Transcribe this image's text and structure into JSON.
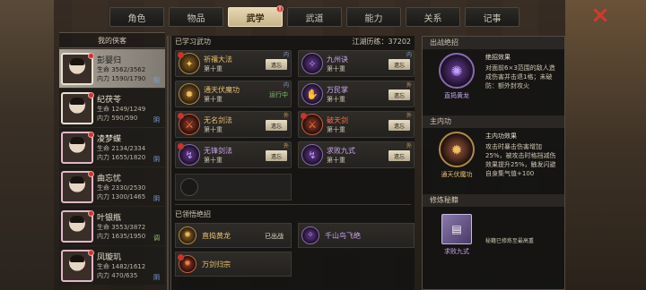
{
  "tabs": [
    {
      "label": "角色",
      "active": false,
      "dot": false
    },
    {
      "label": "物品",
      "active": false,
      "dot": false
    },
    {
      "label": "武学",
      "active": true,
      "dot": true
    },
    {
      "label": "武道",
      "active": false,
      "dot": false
    },
    {
      "label": "能力",
      "active": false,
      "dot": false
    },
    {
      "label": "关系",
      "active": false,
      "dot": false
    },
    {
      "label": "记事",
      "active": false,
      "dot": false
    }
  ],
  "close_icon": "×",
  "char_list": {
    "header": "我的侠客",
    "chars": [
      {
        "name": "彭婴归",
        "hp": "生命 3562/3562",
        "mp": "内力 1590/1790",
        "tag": "阳",
        "selected": true
      },
      {
        "name": "纪茯苓",
        "hp": "生命 1249/1249",
        "mp": "内力 590/590",
        "tag": "阴",
        "selected": false
      },
      {
        "name": "凌梦蝶",
        "hp": "生命 2134/2334",
        "mp": "内力 1655/1820",
        "tag": "阴",
        "selected": false
      },
      {
        "name": "曲忘忧",
        "hp": "生命 2330/2530",
        "mp": "内力 1300/1465",
        "tag": "阴",
        "selected": false
      },
      {
        "name": "叶银瓶",
        "hp": "生命 3553/3872",
        "mp": "内力 1635/1950",
        "tag": "调",
        "selected": false
      },
      {
        "name": "凤璇玑",
        "hp": "生命 1482/1612",
        "mp": "内力 470/635",
        "tag": "阴",
        "selected": false
      }
    ]
  },
  "learned": {
    "title": "已学习武功",
    "exp_label": "江湖历练：37202",
    "skills": [
      {
        "name": "祈禳大法",
        "level": "第十重",
        "action": "遗忘",
        "tag": "内",
        "color": "gold",
        "icon": "✦"
      },
      {
        "name": "九州诀",
        "level": "第十重",
        "action": "遗忘",
        "tag": "内",
        "color": "purple",
        "icon": "✧"
      },
      {
        "name": "通天伏魔功",
        "level": "第十重",
        "action": "运行中",
        "tag": "内",
        "color": "gold",
        "icon": "✹"
      },
      {
        "name": "万民掌",
        "level": "第十重",
        "action": "遗忘",
        "tag": "外",
        "color": "purple",
        "icon": "✋"
      },
      {
        "name": "无名剑法",
        "level": "第十重",
        "action": "遗忘",
        "tag": "外",
        "color": "gold",
        "icon": "⚔"
      },
      {
        "name": "破天剑",
        "level": "第十重",
        "action": "遗忘",
        "tag": "外",
        "color": "red",
        "icon": "⚔"
      },
      {
        "name": "无锋剑法",
        "level": "第十重",
        "action": "遗忘",
        "tag": "外",
        "color": "purple",
        "icon": "↯"
      },
      {
        "name": "求败九式",
        "level": "第十重",
        "action": "遗忘",
        "tag": "外",
        "color": "purple",
        "icon": "↯"
      }
    ]
  },
  "ultimates": {
    "title": "已领悟绝招",
    "items": [
      {
        "name": "直捣黄龙",
        "status": "已出战",
        "color": "gold",
        "icon": "✺"
      },
      {
        "name": "千山鸟飞绝",
        "status": "",
        "color": "purple",
        "icon": "✧"
      },
      {
        "name": "万剑归宗",
        "status": "",
        "color": "gold",
        "icon": "✺"
      }
    ]
  },
  "detail": {
    "battle_title": "出战绝招",
    "battle_skill": "直捣黄龙",
    "battle_effect_title": "绝招效果",
    "battle_effect_text": "对面前6×3范围的敌人造成伤害并击退1格；未破防：额外封攻火",
    "inner_title": "主内功",
    "inner_skill": "通天伏魔功",
    "inner_effect_title": "主内功效果",
    "inner_effect_text": "攻击时暴击伤害增加25%，被攻击时格挡减伤效果提升25%，触发闪避自身集气值+100",
    "secret_title": "修炼秘籍",
    "secret_book": "求败九式",
    "secret_note": "秘籍已修炼至最高重"
  }
}
